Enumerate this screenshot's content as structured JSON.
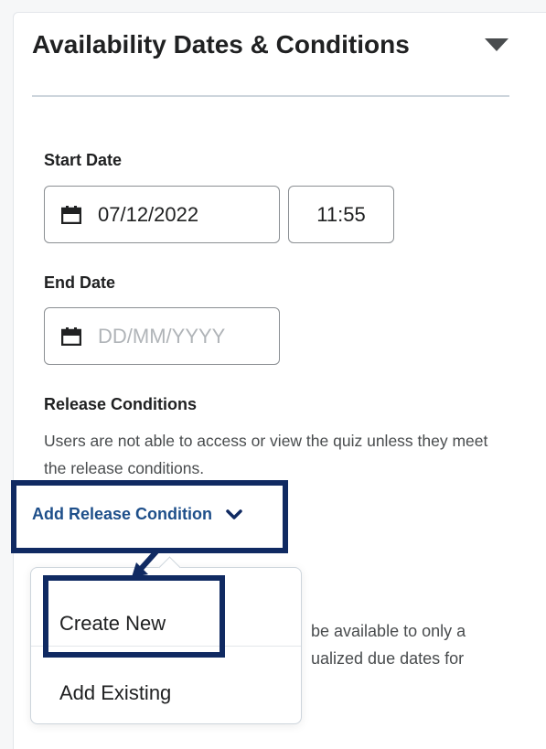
{
  "panel": {
    "title": "Availability Dates & Conditions",
    "collapse_icon": "caret-down-icon"
  },
  "start_date": {
    "label": "Start Date",
    "date_value": "07/12/2022",
    "time_value": "11:55",
    "icon": "calendar-icon"
  },
  "end_date": {
    "label": "End Date",
    "date_value": "",
    "date_placeholder": "DD/MM/YYYY",
    "icon": "calendar-icon"
  },
  "release_conditions": {
    "label": "Release Conditions",
    "description": "Users are not able to access or view the quiz unless they meet the release conditions.",
    "add_button_label": "Add Release Condition",
    "add_button_icon": "chevron-down-icon"
  },
  "partially_hidden_text": {
    "line1": "be available to only a",
    "line2": "ualized due dates for"
  },
  "dropdown": {
    "items": [
      {
        "label": "Create New"
      },
      {
        "label": "Add Existing"
      }
    ]
  },
  "annotation": {
    "highlight_color": "#102a62",
    "arrow_icon": "arrow-down-left-icon"
  },
  "colors": {
    "link": "#1e4f8a",
    "text": "#202122",
    "muted": "#494c4e",
    "placeholder": "#b0b4b8"
  }
}
